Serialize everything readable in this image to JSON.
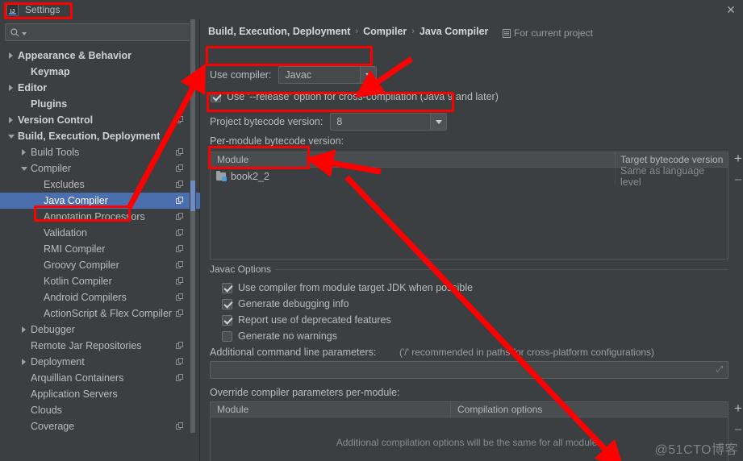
{
  "window": {
    "title": "Settings",
    "app_icon": "intellij-idea-icon",
    "close_icon": "close-icon"
  },
  "search": {
    "placeholder": "",
    "value": "",
    "icon": "search-icon",
    "dropdown_icon": "chevron-down-icon"
  },
  "sidebar": {
    "items": [
      {
        "label": "Appearance & Behavior",
        "indent": 0,
        "toggle": "right",
        "bold": true,
        "copy": false,
        "selected": false
      },
      {
        "label": "Keymap",
        "indent": 1,
        "toggle": "none",
        "bold": true,
        "copy": false,
        "selected": false
      },
      {
        "label": "Editor",
        "indent": 0,
        "toggle": "right",
        "bold": true,
        "copy": false,
        "selected": false
      },
      {
        "label": "Plugins",
        "indent": 1,
        "toggle": "none",
        "bold": true,
        "copy": false,
        "selected": false
      },
      {
        "label": "Version Control",
        "indent": 0,
        "toggle": "right",
        "bold": true,
        "copy": true,
        "selected": false
      },
      {
        "label": "Build, Execution, Deployment",
        "indent": 0,
        "toggle": "down",
        "bold": true,
        "copy": false,
        "selected": false
      },
      {
        "label": "Build Tools",
        "indent": 1,
        "toggle": "right",
        "bold": false,
        "copy": true,
        "selected": false
      },
      {
        "label": "Compiler",
        "indent": 1,
        "toggle": "down",
        "bold": false,
        "copy": true,
        "selected": false
      },
      {
        "label": "Excludes",
        "indent": 2,
        "toggle": "none",
        "bold": false,
        "copy": true,
        "selected": false
      },
      {
        "label": "Java Compiler",
        "indent": 2,
        "toggle": "none",
        "bold": false,
        "copy": true,
        "selected": true
      },
      {
        "label": "Annotation Processors",
        "indent": 2,
        "toggle": "none",
        "bold": false,
        "copy": true,
        "selected": false
      },
      {
        "label": "Validation",
        "indent": 2,
        "toggle": "none",
        "bold": false,
        "copy": true,
        "selected": false
      },
      {
        "label": "RMI Compiler",
        "indent": 2,
        "toggle": "none",
        "bold": false,
        "copy": true,
        "selected": false
      },
      {
        "label": "Groovy Compiler",
        "indent": 2,
        "toggle": "none",
        "bold": false,
        "copy": true,
        "selected": false
      },
      {
        "label": "Kotlin Compiler",
        "indent": 2,
        "toggle": "none",
        "bold": false,
        "copy": true,
        "selected": false
      },
      {
        "label": "Android Compilers",
        "indent": 2,
        "toggle": "none",
        "bold": false,
        "copy": true,
        "selected": false
      },
      {
        "label": "ActionScript & Flex Compiler",
        "indent": 2,
        "toggle": "none",
        "bold": false,
        "copy": true,
        "selected": false
      },
      {
        "label": "Debugger",
        "indent": 1,
        "toggle": "right",
        "bold": false,
        "copy": false,
        "selected": false
      },
      {
        "label": "Remote Jar Repositories",
        "indent": 1,
        "toggle": "none",
        "bold": false,
        "copy": true,
        "selected": false
      },
      {
        "label": "Deployment",
        "indent": 1,
        "toggle": "right",
        "bold": false,
        "copy": true,
        "selected": false
      },
      {
        "label": "Arquillian Containers",
        "indent": 1,
        "toggle": "none",
        "bold": false,
        "copy": true,
        "selected": false
      },
      {
        "label": "Application Servers",
        "indent": 1,
        "toggle": "none",
        "bold": false,
        "copy": false,
        "selected": false
      },
      {
        "label": "Clouds",
        "indent": 1,
        "toggle": "none",
        "bold": false,
        "copy": false,
        "selected": false
      },
      {
        "label": "Coverage",
        "indent": 1,
        "toggle": "none",
        "bold": false,
        "copy": true,
        "selected": false
      }
    ]
  },
  "main": {
    "breadcrumb": {
      "part1": "Build, Execution, Deployment",
      "part2": "Compiler",
      "part3": "Java Compiler",
      "sep": "›"
    },
    "scope": {
      "label": "For current project",
      "icon": "project-scope-icon"
    },
    "use_compiler": {
      "label": "Use compiler:",
      "value": "Javac"
    },
    "release_option": {
      "label": "Use '--release' option for cross-compilation (Java 9 and later)",
      "checked": true
    },
    "project_bytecode": {
      "label": "Project bytecode version:",
      "value": "8"
    },
    "per_module_label": "Per-module bytecode version:",
    "module_table": {
      "headers": {
        "module": "Module",
        "target": "Target bytecode version"
      },
      "rows": [
        {
          "module": "book2_2",
          "target": "Same as language level"
        }
      ],
      "add_label": "+",
      "remove_label": "–"
    },
    "javac_options": {
      "group_title": "Javac Options",
      "options": [
        {
          "label": "Use compiler from module target JDK when possible",
          "checked": true
        },
        {
          "label": "Generate debugging info",
          "checked": true
        },
        {
          "label": "Report use of deprecated features",
          "checked": true
        },
        {
          "label": "Generate no warnings",
          "checked": false
        }
      ],
      "additional_params_label": "Additional command line parameters:",
      "additional_params_hint": "('/' recommended in paths for cross-platform configurations)",
      "additional_params_value": "",
      "expand_icon": "expand-icon"
    },
    "override_section": {
      "label": "Override compiler parameters per-module:",
      "headers": {
        "module": "Module",
        "options": "Compilation options"
      },
      "empty_text": "Additional compilation options will be the same for all modules",
      "add_label": "+",
      "remove_label": "–"
    }
  },
  "watermark": "@51CTO博客",
  "colors": {
    "background": "#3c3f41",
    "selection": "#4b6eaf",
    "annotation": "#fe0000",
    "text": "#bbbbbb"
  }
}
